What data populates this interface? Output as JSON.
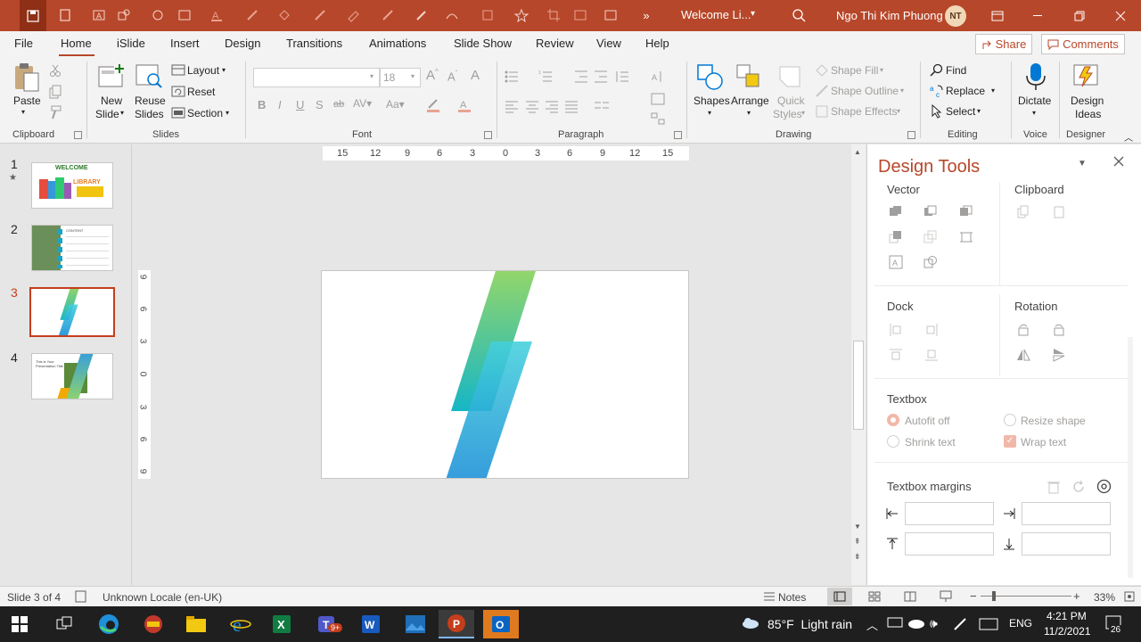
{
  "window": {
    "doc_title": "Welcome Li...",
    "user_name": "Ngo Thi Kim Phuong",
    "user_initials": "NT",
    "accent": "#b7472a"
  },
  "menu": {
    "tabs": [
      "File",
      "Home",
      "iSlide",
      "Insert",
      "Design",
      "Transitions",
      "Animations",
      "Slide Show",
      "Review",
      "View",
      "Help"
    ],
    "active_tab": "Home",
    "share_label": "Share",
    "comments_label": "Comments"
  },
  "ribbon": {
    "clipboard": {
      "label": "Clipboard",
      "paste": "Paste"
    },
    "slides": {
      "label": "Slides",
      "new_slide": "New",
      "new_slide2": "Slide",
      "reuse": "Reuse",
      "reuse2": "Slides",
      "layout": "Layout",
      "reset": "Reset",
      "section": "Section"
    },
    "font": {
      "label": "Font",
      "size": "18"
    },
    "paragraph": {
      "label": "Paragraph"
    },
    "drawing": {
      "label": "Drawing",
      "shapes": "Shapes",
      "arrange": "Arrange",
      "quick_styles": "Quick",
      "quick_styles2": "Styles",
      "shape_fill": "Shape Fill",
      "shape_outline": "Shape Outline",
      "shape_effects": "Shape Effects"
    },
    "editing": {
      "label": "Editing",
      "find": "Find",
      "replace": "Replace",
      "select": "Select"
    },
    "voice": {
      "label": "Voice",
      "dictate": "Dictate"
    },
    "designer": {
      "label": "Designer",
      "design_ideas": "Design",
      "design_ideas2": "Ideas"
    }
  },
  "slides": {
    "numbers": [
      "1",
      "2",
      "3",
      "4"
    ],
    "active": "3",
    "thumb1_text": "WELCOME",
    "thumb1_sub": "LIBRARY",
    "thumb2_text": "CONTENT",
    "thumb4_text": "This is Your Presentation Title"
  },
  "rulers": {
    "h_ticks": [
      "15",
      "12",
      "9",
      "6",
      "3",
      "0",
      "3",
      "6",
      "9",
      "12",
      "15"
    ],
    "v_ticks": [
      "9",
      "6",
      "3",
      "0",
      "3",
      "6",
      "9"
    ]
  },
  "design_pane": {
    "title": "Design Tools",
    "vector": "Vector",
    "clipboard": "Clipboard",
    "dock": "Dock",
    "rotation": "Rotation",
    "textbox": "Textbox",
    "autofit_off": "Autofit off",
    "resize_shape": "Resize shape",
    "shrink_text": "Shrink text",
    "wrap_text": "Wrap text",
    "textbox_margins": "Textbox margins"
  },
  "status": {
    "slide_info": "Slide 3 of 4",
    "locale": "Unknown Locale (en-UK)",
    "notes": "Notes",
    "zoom": "33%"
  },
  "taskbar": {
    "weather": "85°F  Light rain",
    "lang": "ENG",
    "time": "4:21 PM",
    "date": "11/2/2021",
    "notif_count": "26",
    "teams_badge": "9+"
  }
}
